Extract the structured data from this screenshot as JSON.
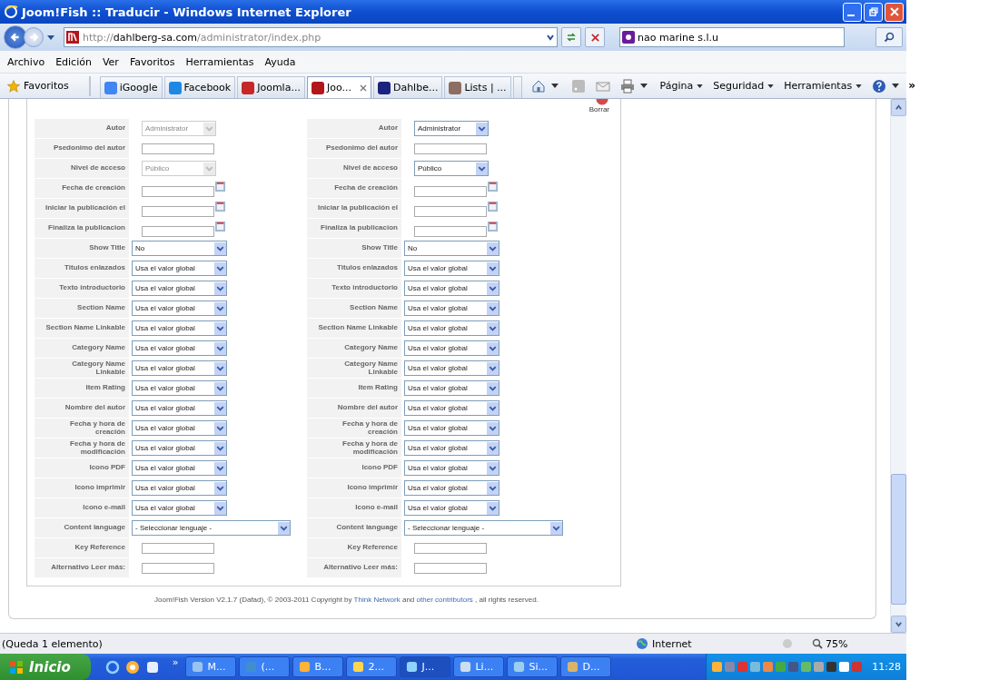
{
  "window": {
    "title": "Joom!Fish :: Traducir - Windows Internet Explorer"
  },
  "address_bar": {
    "scheme": "http://",
    "host": "dahlberg-sa.com",
    "path": "/administrator/index.php"
  },
  "search": {
    "value": "nao marine s.l.u"
  },
  "menu": [
    "Archivo",
    "Edición",
    "Ver",
    "Favoritos",
    "Herramientas",
    "Ayuda"
  ],
  "favorites_button": "Favoritos",
  "tabs": [
    {
      "label": "iGoogle",
      "selected": false
    },
    {
      "label": "Facebook",
      "selected": false
    },
    {
      "label": "Joomla...",
      "selected": false
    },
    {
      "label": "Joo...",
      "selected": true
    },
    {
      "label": "Dahlbe...",
      "selected": false
    },
    {
      "label": "Lists | ...",
      "selected": false
    }
  ],
  "command_bar": [
    "Página",
    "Seguridad",
    "Herramientas"
  ],
  "toolbar_overflow": "»",
  "delete_button": "Borrar",
  "columns": [
    {
      "fields": [
        {
          "label": "Autor",
          "kind": "short-select",
          "value": "Administrator",
          "disabled": true
        },
        {
          "label": "Psedonimo del autor",
          "kind": "text",
          "disabled": false
        },
        {
          "label": "Nivel de acceso",
          "kind": "short-select",
          "value": "Público",
          "disabled": true
        },
        {
          "label": "Fecha de creación",
          "kind": "date",
          "disabled": false
        },
        {
          "label": "Iniciar la publicación el",
          "kind": "date",
          "disabled": false
        },
        {
          "label": "Finaliza la publicacion",
          "kind": "date",
          "disabled": false
        },
        {
          "label": "Show Title",
          "kind": "select",
          "value": "No",
          "disabled": false
        },
        {
          "label": "Titulos enlazados",
          "kind": "select",
          "value": "Usa el valor global",
          "disabled": false
        },
        {
          "label": "Texto introductorio",
          "kind": "select",
          "value": "Usa el valor global",
          "disabled": false
        },
        {
          "label": "Section Name",
          "kind": "select",
          "value": "Usa el valor global",
          "disabled": false
        },
        {
          "label": "Section Name Linkable",
          "kind": "select",
          "value": "Usa el valor global",
          "disabled": false
        },
        {
          "label": "Category Name",
          "kind": "select",
          "value": "Usa el valor global",
          "disabled": false
        },
        {
          "label": "Category Name\nLinkable",
          "kind": "select",
          "value": "Usa el valor global",
          "disabled": false
        },
        {
          "label": "Item Rating",
          "kind": "select",
          "value": "Usa el valor global",
          "disabled": false
        },
        {
          "label": "Nombre del autor",
          "kind": "select",
          "value": "Usa el valor global",
          "disabled": false
        },
        {
          "label": "Fecha y hora de\ncreación",
          "kind": "select",
          "value": "Usa el valor global",
          "disabled": false
        },
        {
          "label": "Fecha y hora de\nmodificación",
          "kind": "select",
          "value": "Usa el valor global",
          "disabled": false
        },
        {
          "label": "Icono PDF",
          "kind": "select",
          "value": "Usa el valor global",
          "disabled": false
        },
        {
          "label": "Icono imprimir",
          "kind": "select",
          "value": "Usa el valor global",
          "disabled": false
        },
        {
          "label": "Icono e-mail",
          "kind": "select",
          "value": "Usa el valor global",
          "disabled": false
        },
        {
          "label": "Content language",
          "kind": "wide-select",
          "value": "- Seleccionar lenguaje -",
          "disabled": false
        },
        {
          "label": "Key Reference",
          "kind": "text",
          "disabled": false
        },
        {
          "label": "Alternativo Leer más:",
          "kind": "text",
          "disabled": false
        }
      ]
    },
    {
      "fields": [
        {
          "label": "Autor",
          "kind": "short-select",
          "value": "Administrator",
          "disabled": false
        },
        {
          "label": "Psedonimo del autor",
          "kind": "text",
          "disabled": false
        },
        {
          "label": "Nivel de acceso",
          "kind": "short-select",
          "value": "Público",
          "disabled": false
        },
        {
          "label": "Fecha de creación",
          "kind": "date",
          "disabled": false
        },
        {
          "label": "Iniciar la publicación el",
          "kind": "date",
          "disabled": false
        },
        {
          "label": "Finaliza la publicacion",
          "kind": "date",
          "disabled": false
        },
        {
          "label": "Show Title",
          "kind": "select",
          "value": "No",
          "disabled": false
        },
        {
          "label": "Titulos enlazados",
          "kind": "select",
          "value": "Usa el valor global",
          "disabled": false
        },
        {
          "label": "Texto introductorio",
          "kind": "select",
          "value": "Usa el valor global",
          "disabled": false
        },
        {
          "label": "Section Name",
          "kind": "select",
          "value": "Usa el valor global",
          "disabled": false
        },
        {
          "label": "Section Name Linkable",
          "kind": "select",
          "value": "Usa el valor global",
          "disabled": false
        },
        {
          "label": "Category Name",
          "kind": "select",
          "value": "Usa el valor global",
          "disabled": false
        },
        {
          "label": "Category Name\nLinkable",
          "kind": "select",
          "value": "Usa el valor global",
          "disabled": false
        },
        {
          "label": "Item Rating",
          "kind": "select",
          "value": "Usa el valor global",
          "disabled": false
        },
        {
          "label": "Nombre del autor",
          "kind": "select",
          "value": "Usa el valor global",
          "disabled": false
        },
        {
          "label": "Fecha y hora de\ncreación",
          "kind": "select",
          "value": "Usa el valor global",
          "disabled": false
        },
        {
          "label": "Fecha y hora de\nmodificación",
          "kind": "select",
          "value": "Usa el valor global",
          "disabled": false
        },
        {
          "label": "Icono PDF",
          "kind": "select",
          "value": "Usa el valor global",
          "disabled": false
        },
        {
          "label": "Icono imprimir",
          "kind": "select",
          "value": "Usa el valor global",
          "disabled": false
        },
        {
          "label": "Icono e-mail",
          "kind": "select",
          "value": "Usa el valor global",
          "disabled": false
        },
        {
          "label": "Content language",
          "kind": "wide-select",
          "value": "- Seleccionar lenguaje -",
          "disabled": false
        },
        {
          "label": "Key Reference",
          "kind": "text",
          "disabled": false
        },
        {
          "label": "Alternativo Leer más:",
          "kind": "text",
          "disabled": false
        }
      ]
    }
  ],
  "footer": [
    {
      "kind": "text",
      "text": "Joom!Fish Version V2.1.7 (Dafad), © 2003-2011 Copyright by"
    },
    {
      "kind": "link",
      "text": "Think Network"
    },
    {
      "kind": "text",
      "text": "and"
    },
    {
      "kind": "link",
      "text": "other contributors"
    },
    {
      "kind": "text",
      "text": ", all rights reserved."
    }
  ],
  "status_bar": {
    "text": "(Queda 1 elemento)",
    "zone": "Internet",
    "zoom": "75%"
  },
  "taskbar": {
    "start": "Inicio",
    "overflow": "»",
    "tasks": [
      {
        "label": "M...",
        "selected": false
      },
      {
        "label": "(...",
        "selected": false
      },
      {
        "label": "B...",
        "selected": false
      },
      {
        "label": "2...",
        "selected": false
      },
      {
        "label": "J...",
        "selected": true
      },
      {
        "label": "Li...",
        "selected": false
      },
      {
        "label": "Si...",
        "selected": false
      },
      {
        "label": "D...",
        "selected": false
      }
    ],
    "clock": "11:28"
  }
}
